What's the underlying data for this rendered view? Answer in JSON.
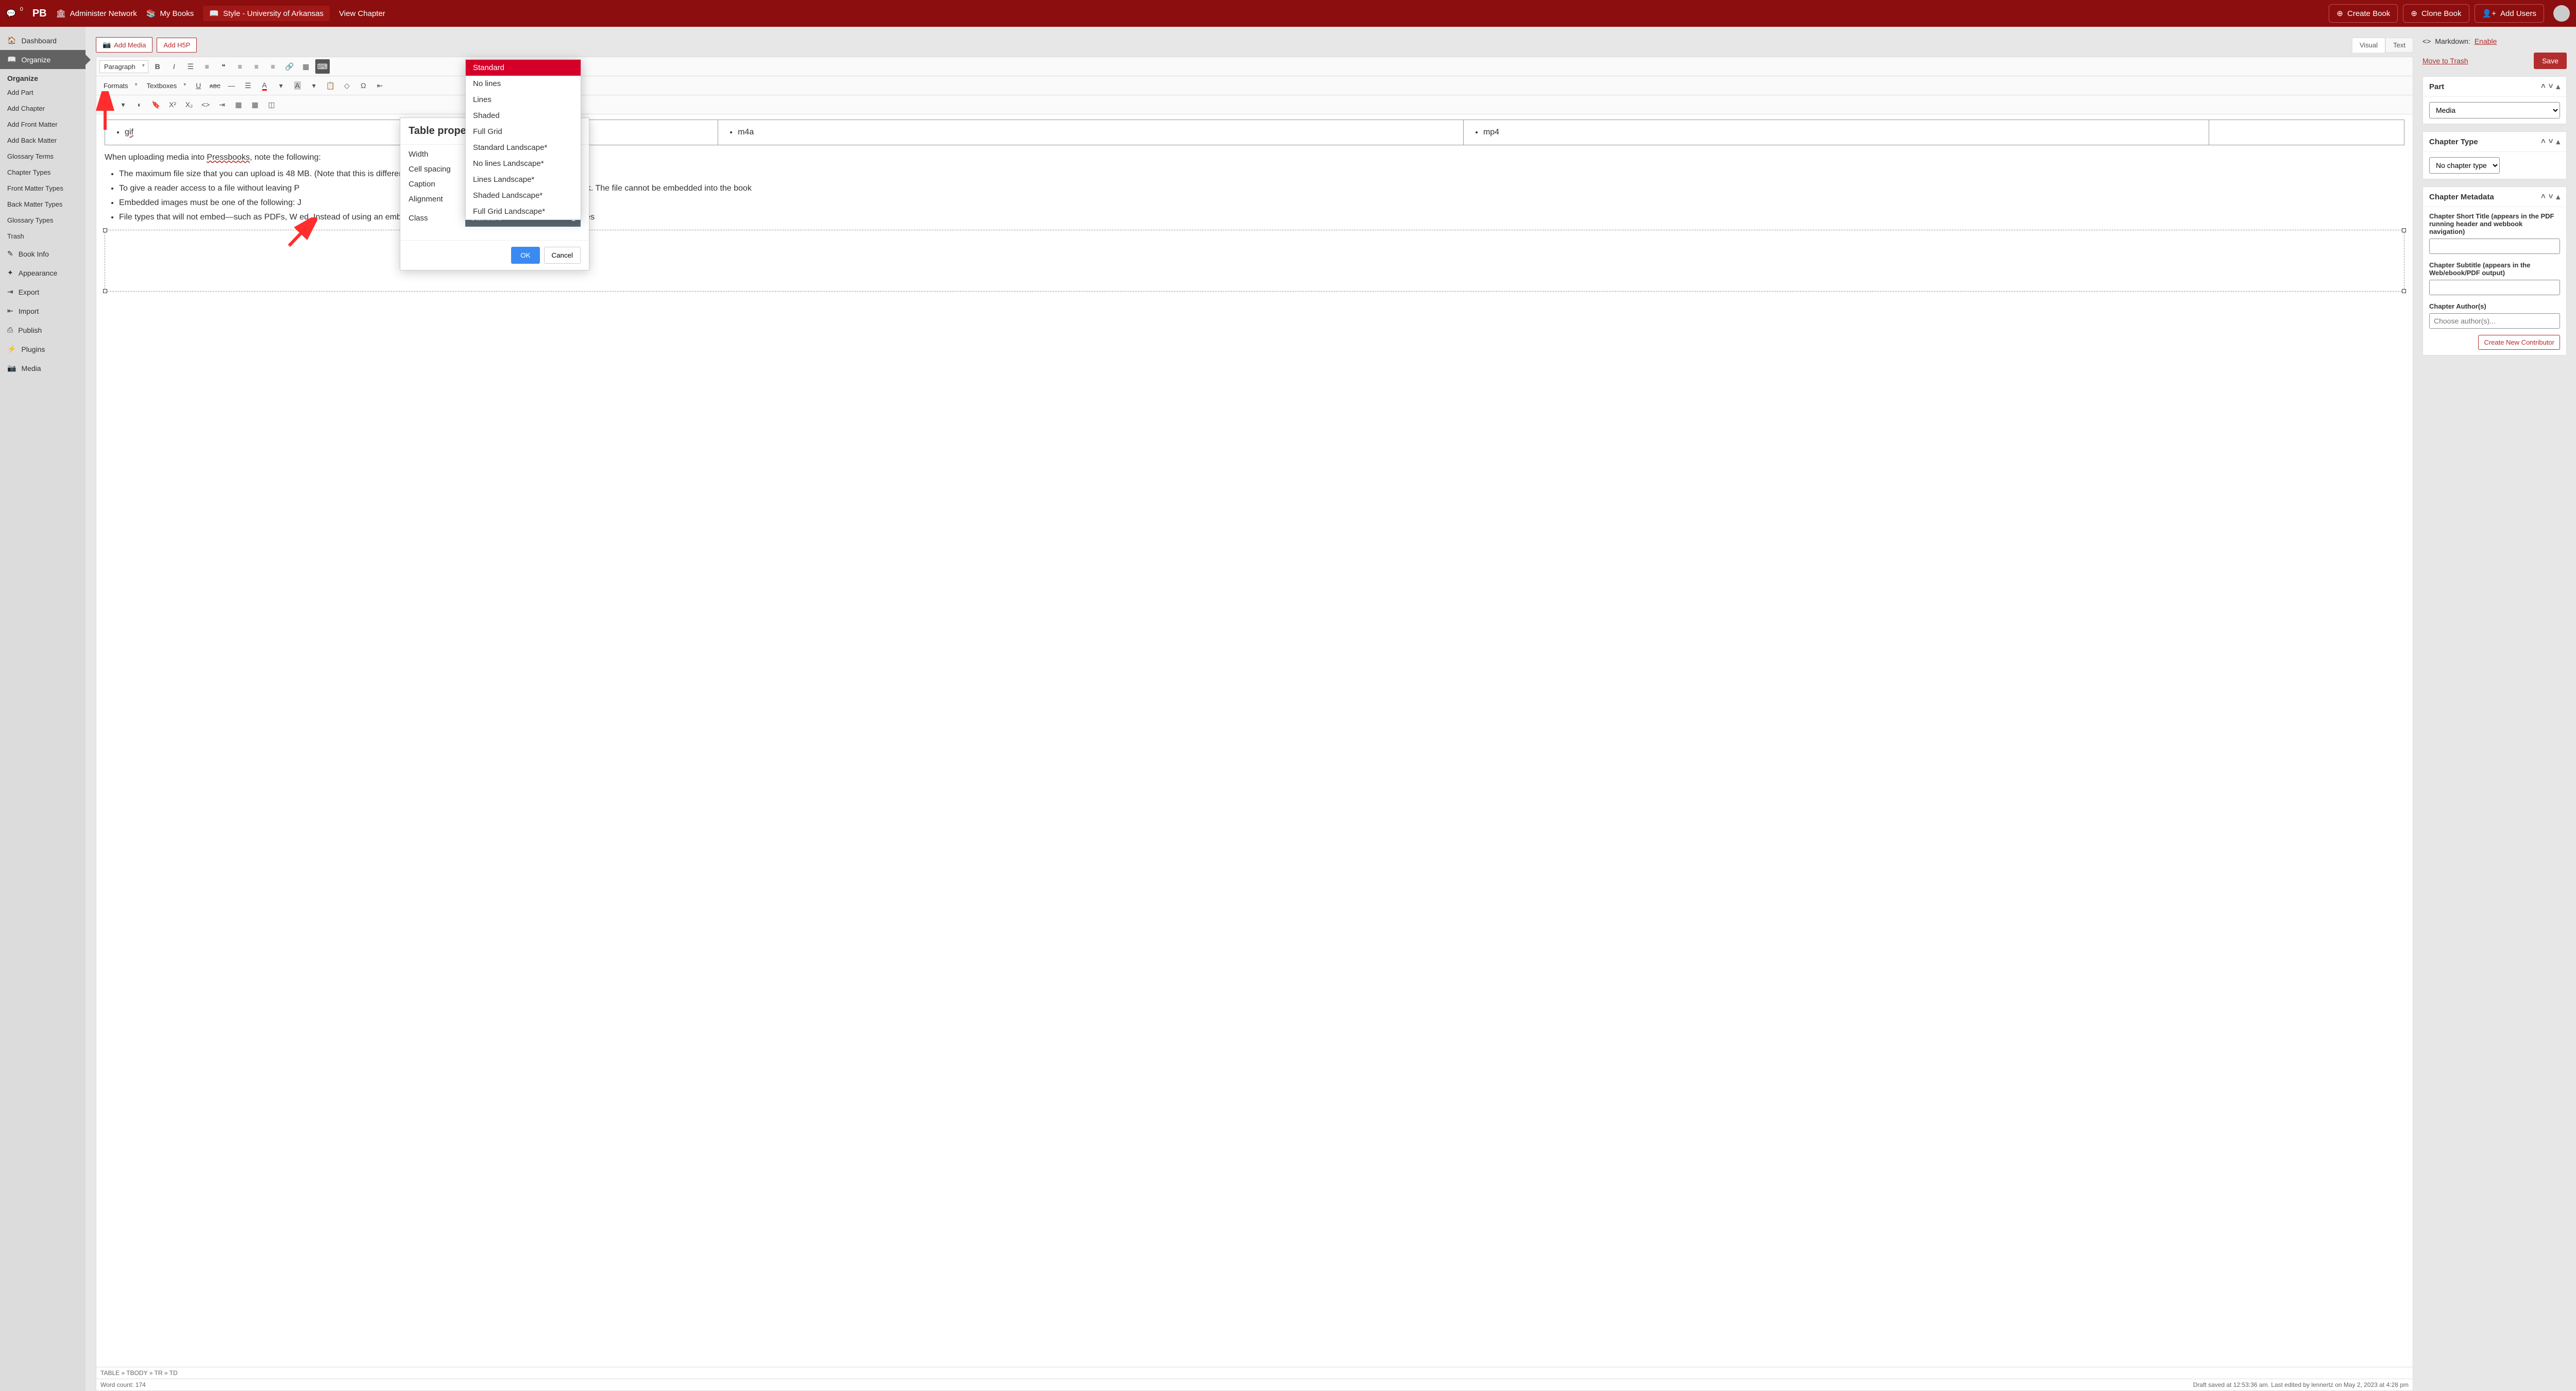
{
  "topbar": {
    "comment_count": "0",
    "logo": "PB",
    "admin": "Administer Network",
    "mybooks": "My Books",
    "book_title": "Style - University of Arkansas",
    "view_chapter": "View Chapter",
    "create_book": "Create Book",
    "clone_book": "Clone Book",
    "add_users": "Add Users"
  },
  "sidebar": {
    "dashboard": "Dashboard",
    "organize": "Organize",
    "heading": "Organize",
    "add_part": "Add Part",
    "add_chapter": "Add Chapter",
    "add_front": "Add Front Matter",
    "add_back": "Add Back Matter",
    "glossary_terms": "Glossary Terms",
    "chapter_types": "Chapter Types",
    "front_types": "Front Matter Types",
    "back_types": "Back Matter Types",
    "glossary_types": "Glossary Types",
    "trash": "Trash",
    "book_info": "Book Info",
    "appearance": "Appearance",
    "export": "Export",
    "import": "Import",
    "publish": "Publish",
    "plugins": "Plugins",
    "media": "Media"
  },
  "editor_top": {
    "add_media": "Add Media",
    "add_h5p": "Add H5P",
    "visual": "Visual",
    "text": "Text"
  },
  "toolbar": {
    "paragraph": "Paragraph",
    "formats": "Formats",
    "textboxes": "Textboxes"
  },
  "body": {
    "cell_gif": "gif",
    "cell_m4a": "m4a",
    "cell_mp4": "mp4",
    "para1_a": "When uploading media into ",
    "para1_b": "Pressbooks",
    "para1_c": ", note the following:",
    "li1": "The maximum file size that you can upload is 48 MB. (Note that this is different from the import-size limit, which is much larger.)",
    "li2_a": "To give a reader access to a file without leaving P",
    "li2_b": "ary before inserting it into the book. The file cannot be embedded into the book",
    "li3": "Embedded images must be one of the following: J",
    "li4": "File types that will not embed—such as PDFs, W                                                   ed. Instead of using an embed-ded image, readers can download these file types"
  },
  "path": "TABLE » TBODY » TR » TD",
  "status": {
    "wordcount": "Word count: 174",
    "draft": "Draft saved at 12:53:36 am. Last edited by lennertz on May 2, 2023 at 4:28 pm"
  },
  "right": {
    "markdown_label": "Markdown:",
    "markdown_link": "Enable",
    "trash": "Move to Trash",
    "save": "Save",
    "part_title": "Part",
    "part_value": "Media",
    "chaptype_title": "Chapter Type",
    "chaptype_value": "No chapter type",
    "meta_title": "Chapter Metadata",
    "short_title_label": "Chapter Short Title (appears in the PDF running header and webbook navigation)",
    "subtitle_label": "Chapter Subtitle (appears in the Web/ebook/PDF output)",
    "authors_label": "Chapter Author(s)",
    "authors_placeholder": "Choose author(s)...",
    "create_contrib": "Create New Contributor"
  },
  "modal": {
    "title": "Table proper",
    "width": "Width",
    "spacing": "Cell spacing",
    "caption": "Caption",
    "alignment": "Alignment",
    "class": "Class",
    "class_value": "Standard",
    "ok": "OK",
    "cancel": "Cancel"
  },
  "dropdown": {
    "items": [
      "Standard",
      "No lines",
      "Lines",
      "Shaded",
      "Full Grid",
      "Standard Landscape*",
      "No lines Landscape*",
      "Lines Landscape*",
      "Shaded Landscape*",
      "Full Grid Landscape*"
    ]
  }
}
